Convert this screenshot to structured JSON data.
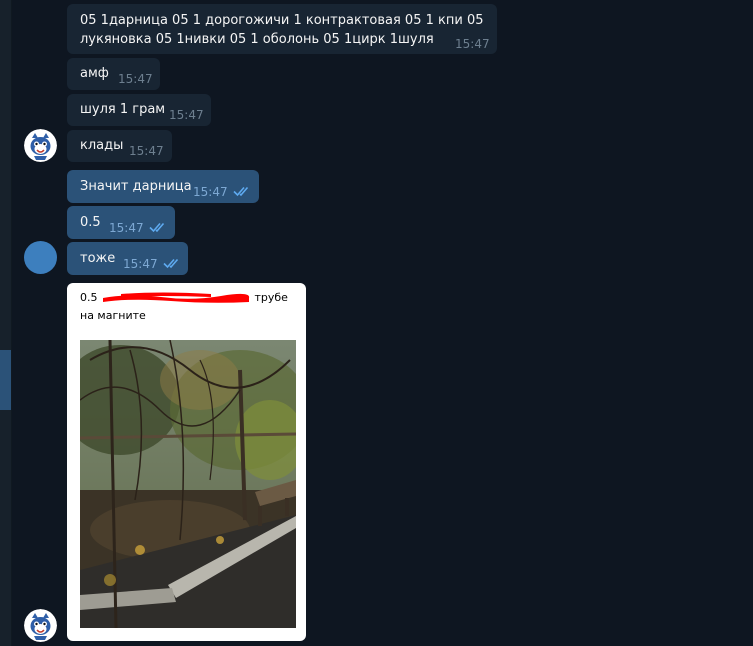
{
  "messages": [
    {
      "text_line1": "05 1дарница 05 1 дорогожичи 1 контрактовая  05 1 кпи 05",
      "text_line2": "лукяновка 05 1нивки 05 1 оболонь    05 1цирк   1шуля",
      "time": "15:47"
    },
    {
      "text": "амф",
      "time": "15:47"
    },
    {
      "text": "шуля 1 грам",
      "time": "15:47"
    },
    {
      "text": "клады",
      "time": "15:47"
    },
    {
      "text": "Значит дарница",
      "time": "15:47"
    },
    {
      "text": "0.5",
      "time": "15:47"
    },
    {
      "text": "тоже",
      "time": "15:47"
    }
  ],
  "photo_message": {
    "caption_start": "0.5",
    "caption_end": "трубе",
    "caption_line2": "на магните"
  },
  "colors": {
    "background": "#0e1621",
    "incoming_bubble": "#182533",
    "outgoing_bubble": "#2b5278",
    "read_ticks": "#5eaaf0",
    "redaction": "#ff0000"
  },
  "icons": [
    "double-check-icon",
    "avatar-image",
    "photo-image"
  ]
}
